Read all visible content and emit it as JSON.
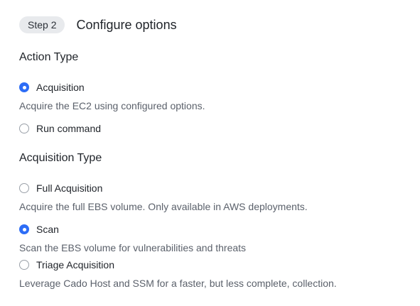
{
  "header": {
    "step_badge": "Step 2",
    "title": "Configure options"
  },
  "action_type": {
    "title": "Action Type",
    "options": [
      {
        "label": "Acquisition",
        "description": "Acquire the EC2 using configured options.",
        "selected": true
      },
      {
        "label": "Run command",
        "description": "",
        "selected": false
      }
    ]
  },
  "acquisition_type": {
    "title": "Acquisition Type",
    "options": [
      {
        "label": "Full Acquisition",
        "description": "Acquire the full EBS volume. Only available in AWS deployments.",
        "selected": false
      },
      {
        "label": "Scan",
        "description": "Scan the EBS volume for vulnerabilities and threats",
        "selected": true
      },
      {
        "label": "Triage Acquisition",
        "description": "Leverage Cado Host and SSM for a faster, but less complete, collection.",
        "selected": false
      }
    ]
  },
  "colors": {
    "accent": "#2d6df6",
    "badge_bg": "#e8eaed",
    "text": "#1f2329",
    "muted_text": "#5b616b"
  }
}
